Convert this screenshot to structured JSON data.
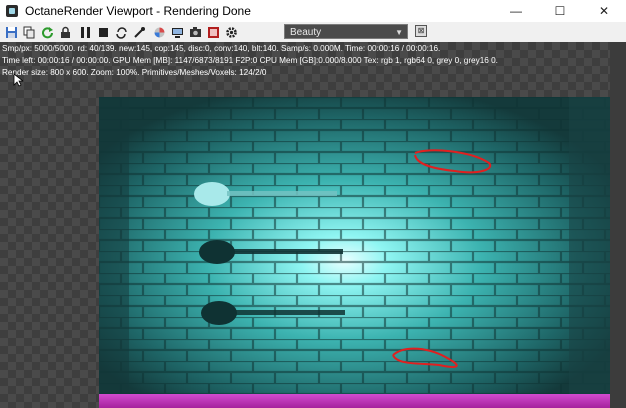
{
  "window": {
    "title": "OctaneRender Viewport - Rendering Done",
    "minimize": "—",
    "maximize": "☐",
    "close": "✕"
  },
  "toolbar": {
    "icons": [
      "save-render-icon",
      "copy-icon",
      "restart-icon",
      "lock-icon",
      "pause-icon",
      "stop-icon",
      "refresh-icon",
      "color-picker-icon",
      "region-icon",
      "display-icon",
      "camera-icon",
      "film-icon",
      "settings-gear-icon"
    ],
    "render_pass": "Beauty",
    "dropdown_arrow": "▼",
    "snap": "⊠"
  },
  "stats": {
    "line1": "Smp/px: 5000/5000.   rd: 40/139.   new:145, cop:145, disc:0, conv:140, blt:140.   Samp/s: 0.000M.   Time: 00:00:16 / 00:00:16.",
    "line2": "Time left: 00:00:16 / 00:00:00.   GPU Mem [MB]: 1147/6873/8191 F2P:0   CPU Mem [GB]:0.000/8.000   Tex: rgb 1, rgb64 0, grey 0, grey16 0.",
    "line3": "Render size: 800 x 600.   Zoom: 100%.   Primitives/Meshes/Voxels: 124/2/0"
  },
  "colors": {
    "wall_glow": "#8ff5f2",
    "wall_dark": "#1d4b4d",
    "floor": "#c03ab8",
    "annotation": "#e02020"
  }
}
